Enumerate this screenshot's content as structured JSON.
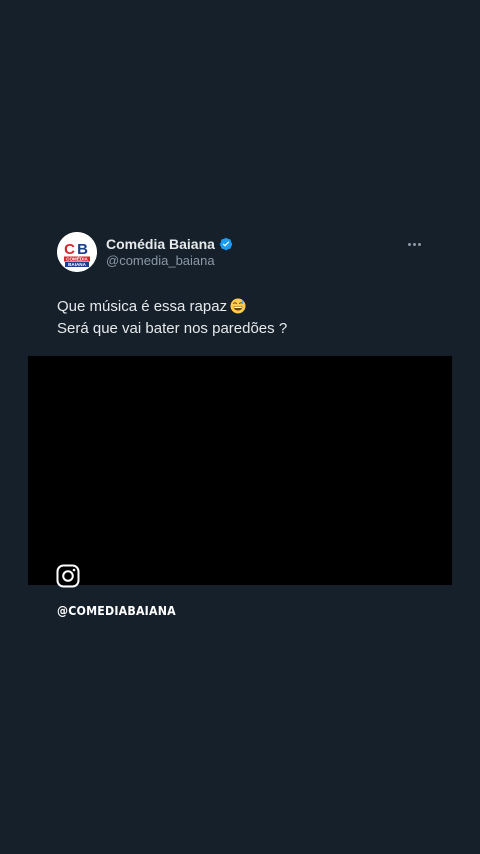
{
  "tweet": {
    "author": {
      "display_name": "Comédia Baiana",
      "handle": "@comedia_baiana",
      "verified": true,
      "avatar": {
        "logo_letters": "CB",
        "logo_text_line1": "COMÉDIA",
        "logo_text_line2": "BAIANA"
      }
    },
    "text_lines": [
      "Que música é essa rapaz",
      "Será que vai bater nos paredões ?"
    ],
    "emoji": "grinning-face-with-sweat",
    "more_icon": "more-horizontal-icon",
    "media": {
      "overlay_icon": "instagram-icon"
    }
  },
  "watermark": "@COMEDIABAIANA",
  "colors": {
    "background": "#15202b",
    "text_primary": "#e7e9ea",
    "text_secondary": "#8b98a5",
    "verified_blue": "#1d9bf0",
    "media_background": "#000000",
    "logo_red": "#d7262c",
    "logo_blue": "#1b3f8f"
  }
}
